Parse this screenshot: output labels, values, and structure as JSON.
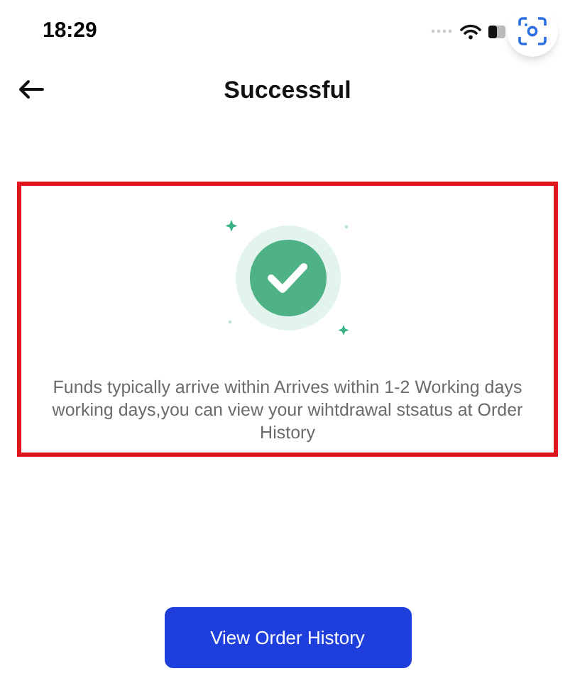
{
  "status_bar": {
    "time": "18:29"
  },
  "header": {
    "title": "Successful"
  },
  "message": "Funds typically arrive within Arrives within 1-2 Working days working days,you can view your wihtdrawal stsatus at Order History",
  "button": {
    "label": "View Order History"
  }
}
